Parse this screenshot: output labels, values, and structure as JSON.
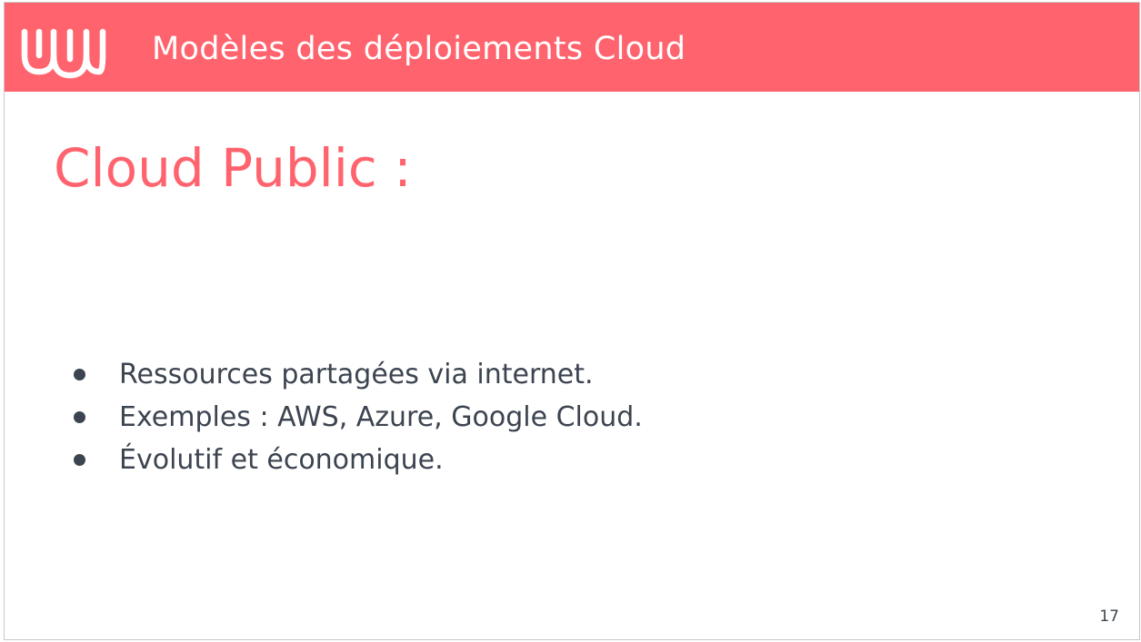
{
  "header": {
    "title": "Modèles des déploiements Cloud",
    "logo_icon": "wave-logo-icon"
  },
  "slide": {
    "title": "Cloud Public :",
    "bullets": [
      "Ressources partagées via internet.",
      "Exemples : AWS, Azure, Google Cloud.",
      "Évolutif et économique."
    ],
    "page_number": "17"
  },
  "colors": {
    "accent": "#ff646e",
    "text": "#3c4450",
    "background": "#ffffff"
  }
}
